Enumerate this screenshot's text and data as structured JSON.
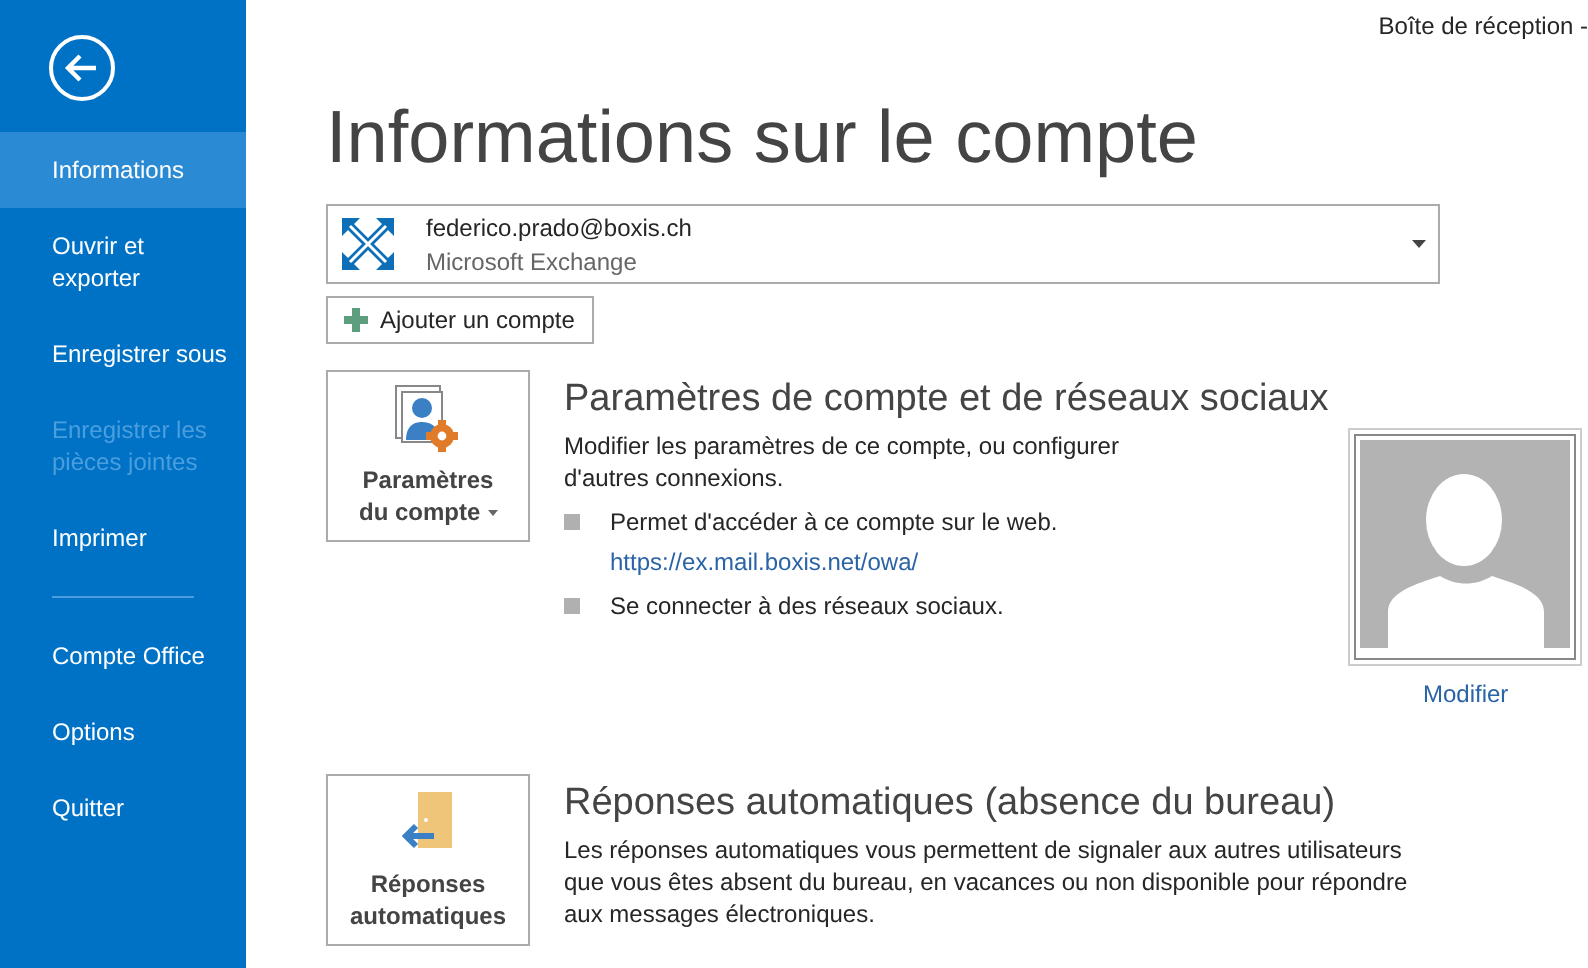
{
  "sidebar": {
    "items": [
      {
        "kind": "item",
        "label": "Informations",
        "selected": true,
        "disabled": false
      },
      {
        "kind": "item",
        "label": "Ouvrir et exporter",
        "selected": false,
        "disabled": false
      },
      {
        "kind": "item",
        "label": "Enregistrer sous",
        "selected": false,
        "disabled": false
      },
      {
        "kind": "item",
        "label": "Enregistrer les pièces jointes",
        "selected": false,
        "disabled": true
      },
      {
        "kind": "item",
        "label": "Imprimer",
        "selected": false,
        "disabled": false
      },
      {
        "kind": "divider"
      },
      {
        "kind": "item",
        "label": "Compte Office",
        "selected": false,
        "disabled": false
      },
      {
        "kind": "item",
        "label": "Options",
        "selected": false,
        "disabled": false
      },
      {
        "kind": "item",
        "label": "Quitter",
        "selected": false,
        "disabled": false
      }
    ]
  },
  "header_link": "Boîte de réception -",
  "title": "Informations sur le compte",
  "account": {
    "email": "federico.prado@boxis.ch",
    "type": "Microsoft Exchange"
  },
  "add_account": "Ajouter un compte",
  "sections": [
    {
      "kind": "settings",
      "button": [
        "Paramètres",
        "du compte"
      ],
      "heading": "Paramètres de compte et de réseaux sociaux",
      "description": "Modifier les paramètres de ce compte, ou configurer d'autres connexions.",
      "bullets": [
        {
          "text": "Permet d'accéder à ce compte sur le web.",
          "link": "https://ex.mail.boxis.net/owa/"
        },
        {
          "text": "Se connecter à des réseaux sociaux."
        }
      ],
      "photo_link": "Modifier"
    },
    {
      "kind": "auto_reply",
      "button": [
        "Réponses",
        "automatiques"
      ],
      "heading": "Réponses automatiques (absence du bureau)",
      "description": "Les réponses automatiques vous permettent de signaler aux autres utilisateurs que vous êtes absent du bureau, en vacances ou non disponible pour répondre aux messages électroniques."
    }
  ]
}
